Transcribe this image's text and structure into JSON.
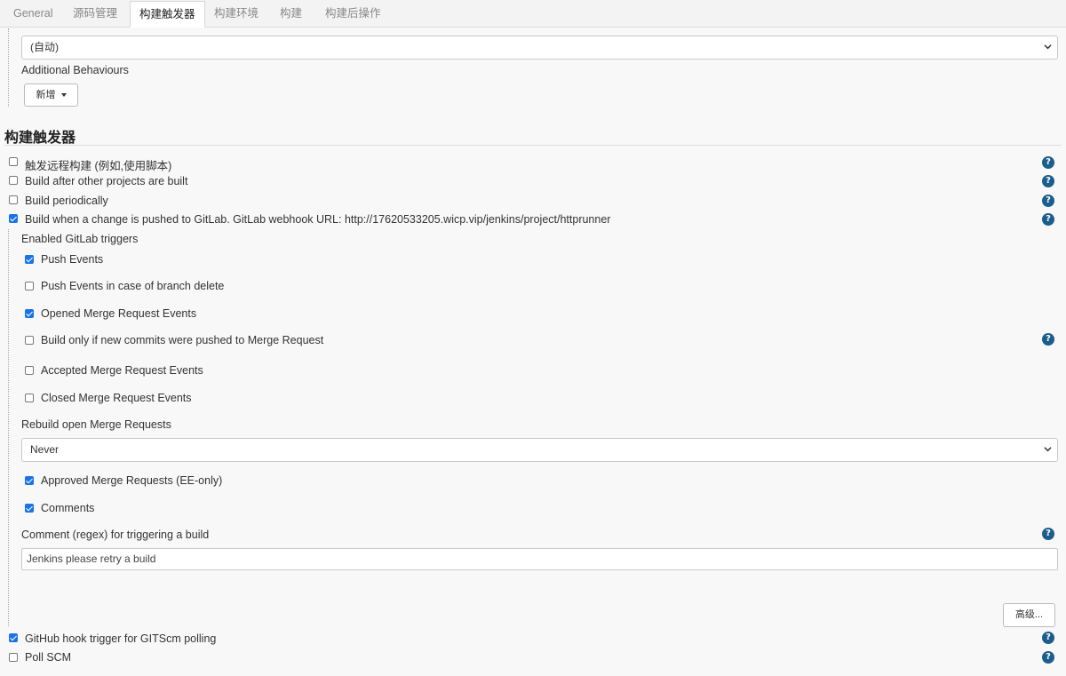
{
  "tabs": [
    "General",
    "源码管理",
    "构建触发器",
    "构建环境",
    "构建",
    "构建后操作"
  ],
  "active_tab": "构建触发器",
  "top_select": {
    "value": "(自动)"
  },
  "additional_behaviours": {
    "label": "Additional Behaviours",
    "add_button": "新增"
  },
  "section_title": "构建触发器",
  "triggers": [
    {
      "label": "触发远程构建 (例如,使用脚本)",
      "checked": false
    },
    {
      "label": "Build after other projects are built",
      "checked": false
    },
    {
      "label": "Build periodically",
      "checked": false
    },
    {
      "label": "Build when a change is pushed to GitLab. GitLab webhook URL: http://17620533205.wicp.vip/jenkins/project/httprunner",
      "checked": true
    }
  ],
  "gitlab": {
    "enabled_triggers_label": "Enabled GitLab triggers",
    "events": [
      {
        "label": "Push Events",
        "checked": true
      },
      {
        "label": "Push Events in case of branch delete",
        "checked": false
      },
      {
        "label": "Opened Merge Request Events",
        "checked": true
      },
      {
        "label": "Build only if new commits were pushed to Merge Request",
        "checked": false
      },
      {
        "label": "Accepted Merge Request Events",
        "checked": false
      },
      {
        "label": "Closed Merge Request Events",
        "checked": false
      }
    ],
    "rebuild_label": "Rebuild open Merge Requests",
    "rebuild_value": "Never",
    "approved": {
      "label": "Approved Merge Requests (EE-only)",
      "checked": true
    },
    "comments": {
      "label": "Comments",
      "checked": true
    },
    "comment_regex_label": "Comment (regex) for triggering a build",
    "comment_regex_value": "Jenkins please retry a build",
    "advanced_button": "高级..."
  },
  "bottom_triggers": [
    {
      "label": "GitHub hook trigger for GITScm polling",
      "checked": true
    },
    {
      "label": "Poll SCM",
      "checked": false
    }
  ],
  "help_glyph": "?",
  "colors": {
    "checkbox_checked": "#1a73e8",
    "help_icon": "#1b5d8c"
  }
}
